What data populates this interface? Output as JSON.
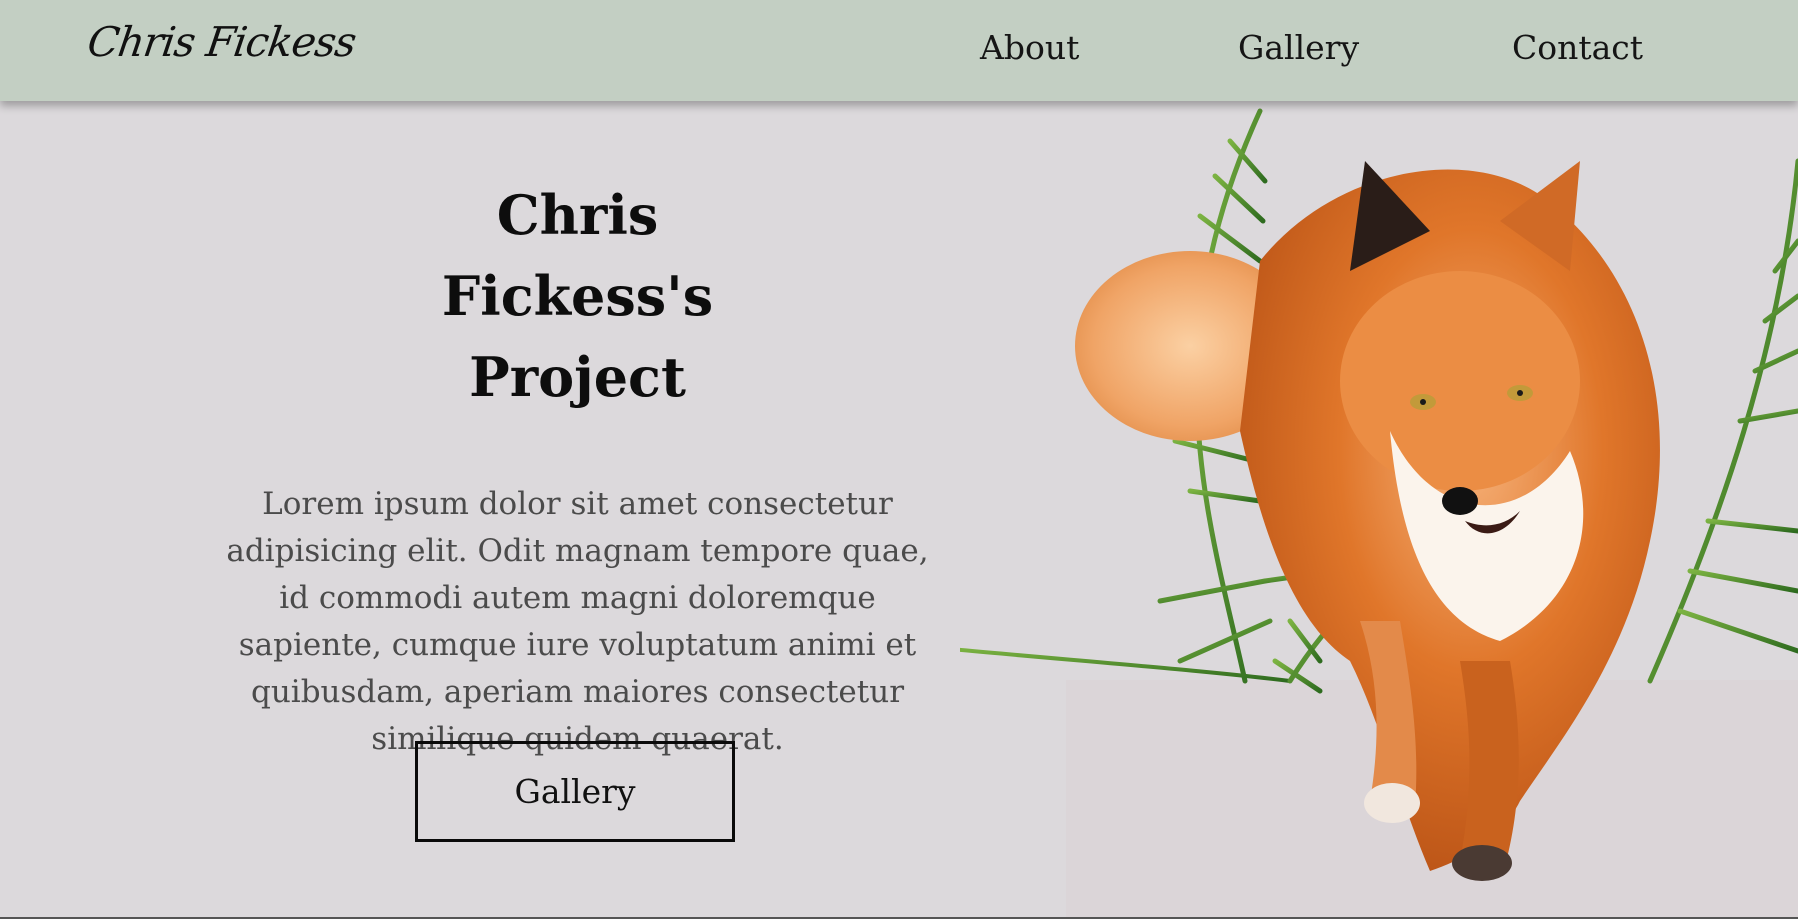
{
  "header": {
    "logo": "Chris Fickess",
    "nav": {
      "about": "About",
      "gallery": "Gallery",
      "contact": "Contact"
    }
  },
  "hero": {
    "title": "Chris Fickess's Project",
    "body": "Lorem ipsum dolor sit amet consectetur adipisicing elit. Odit magnam tempore quae, id commodi autem magni doloremque sapiente, cumque iure voluptatum animi et quibusdam, aperiam maiores consectetur similique quidem quaerat.",
    "button_label": "Gallery"
  },
  "illustration": {
    "subject": "fox-with-palm-leaves",
    "colors": {
      "fur": "#e0762a",
      "fur_light": "#f6b27a",
      "leaf": "#4f8f2e"
    }
  },
  "colors": {
    "header_bg": "#c3cfc3",
    "page_bg": "#dcd9dc",
    "text": "#0d0d0d",
    "body_text": "#4b4b4b"
  }
}
